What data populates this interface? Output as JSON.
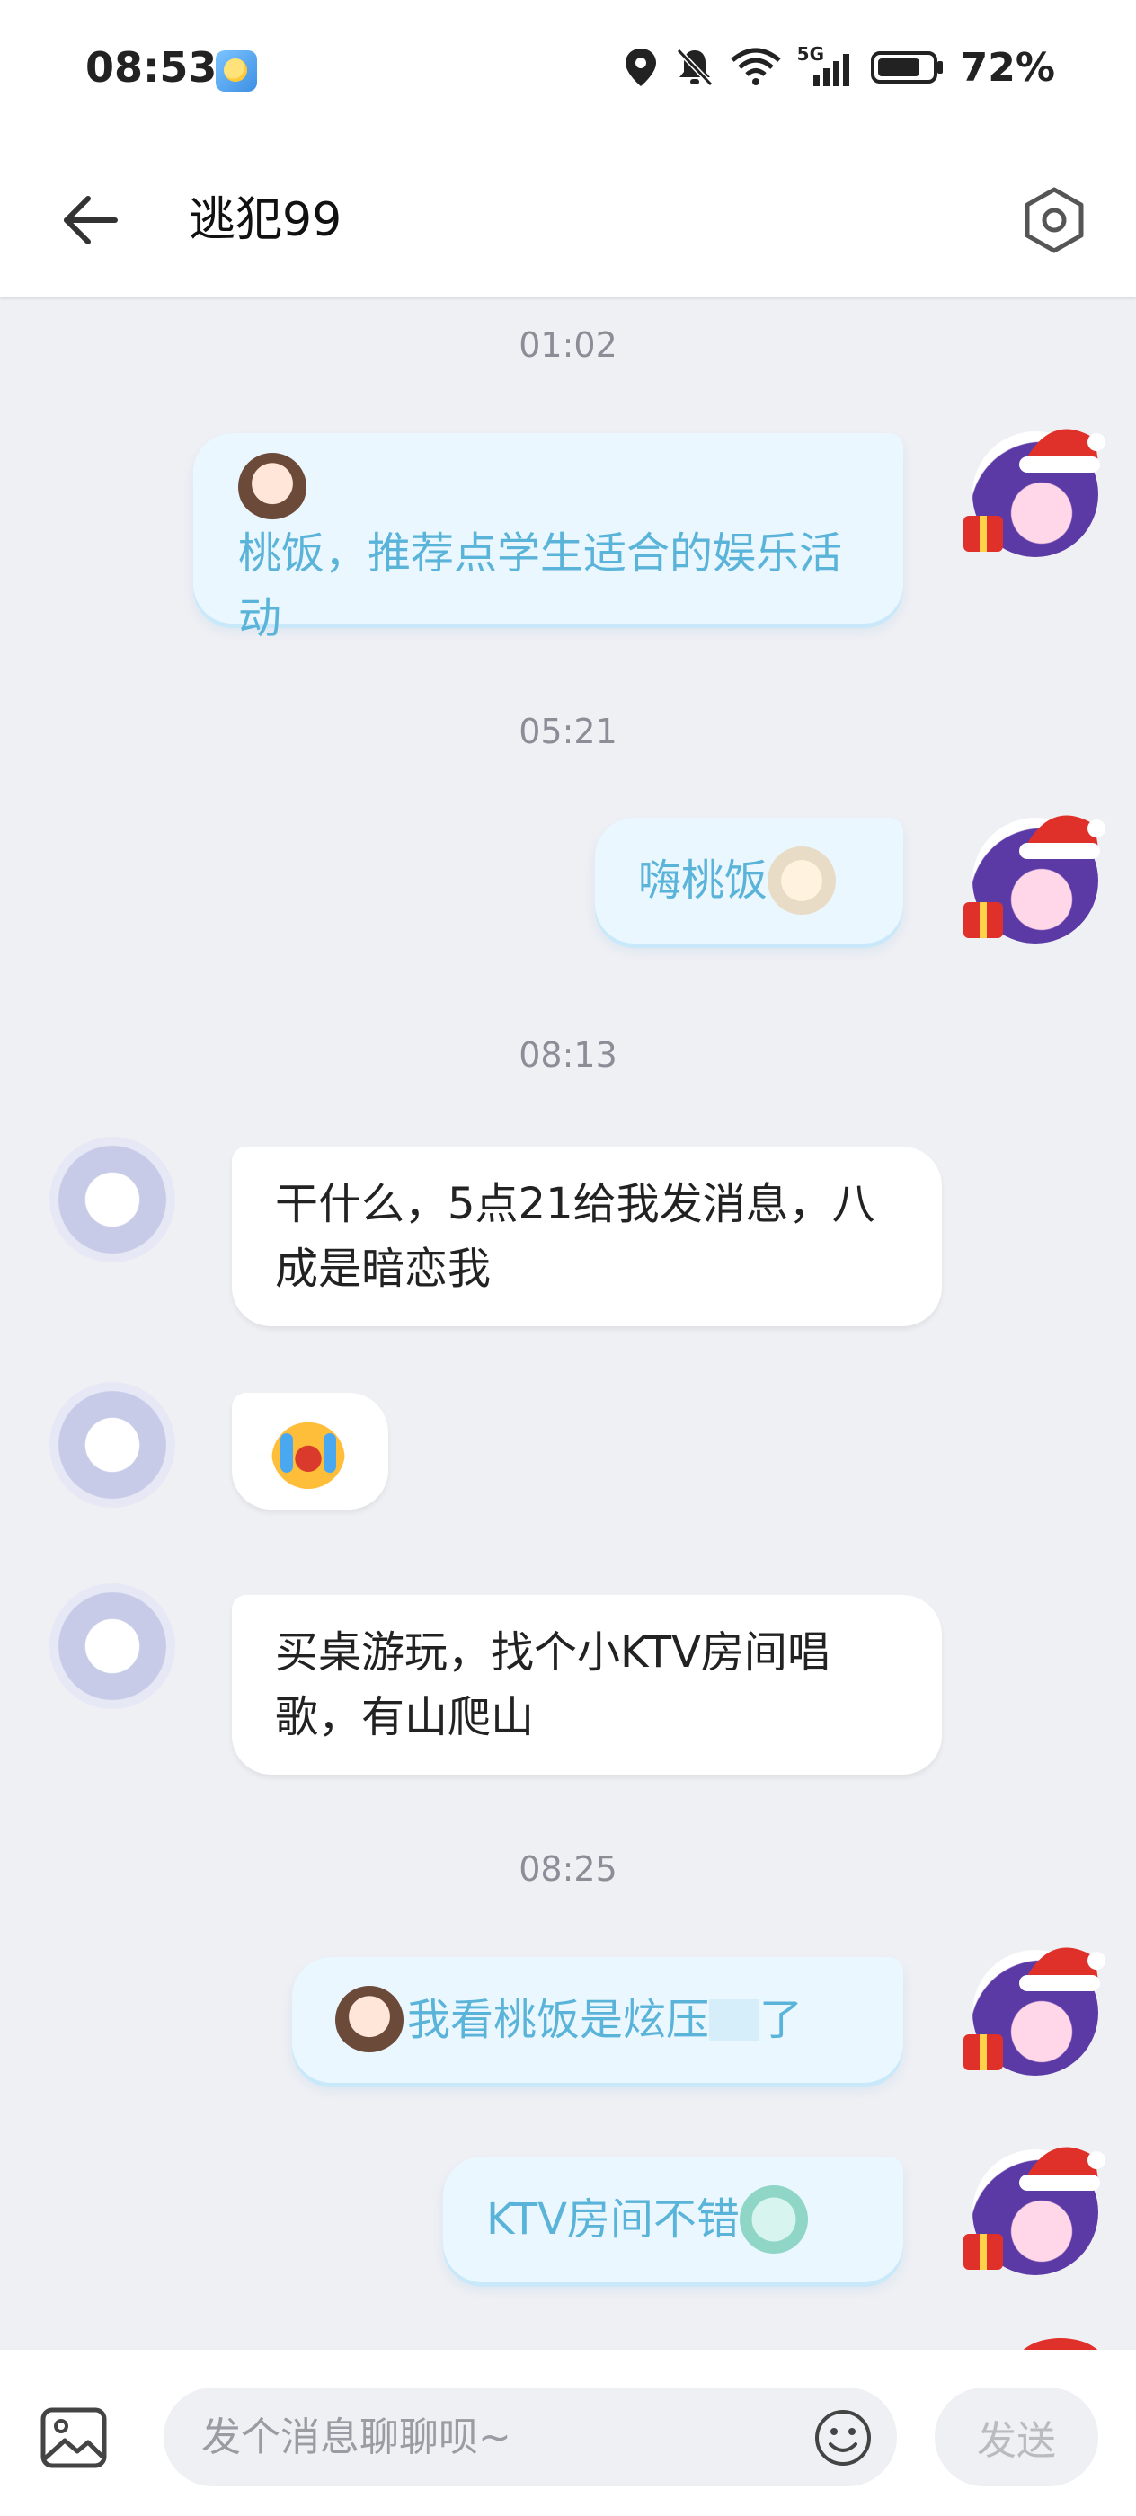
{
  "status_bar": {
    "time": "08:53",
    "network": "5G",
    "battery": "72%"
  },
  "header": {
    "title": "逃犯99"
  },
  "messages": [
    {
      "type": "timestamp",
      "text": "01:02"
    },
    {
      "type": "outgoing",
      "text": "桃饭，推荐点学生适合的娱乐活动",
      "sticker": "anime-girl-sticker"
    },
    {
      "type": "timestamp",
      "text": "05:21"
    },
    {
      "type": "outgoing",
      "text": "嗨桃饭",
      "sticker": "anime-girl-sticker"
    },
    {
      "type": "timestamp",
      "text": "08:13"
    },
    {
      "type": "incoming",
      "text": "干什么，5点21给我发消息，八成是暗恋我"
    },
    {
      "type": "incoming",
      "sticker": "crying-emoji"
    },
    {
      "type": "incoming",
      "text": "买桌游玩，找个小KTV房间唱歌，有山爬山"
    },
    {
      "type": "timestamp",
      "text": "08:25"
    },
    {
      "type": "outgoing",
      "text_before": "我看桃饭是炫压",
      "text_after": "了",
      "sticker": "anime-girl-sticker"
    },
    {
      "type": "outgoing",
      "text": "KTV房间不错",
      "sticker": "anime-girl-sticker"
    }
  ],
  "composer": {
    "placeholder": "发个消息聊聊呗~",
    "send_label": "发送"
  },
  "colors": {
    "background": "#eff0f4",
    "outgoing_bubble": "#eaf7fe",
    "outgoing_text": "#5ab3d8",
    "incoming_bubble": "#ffffff"
  }
}
